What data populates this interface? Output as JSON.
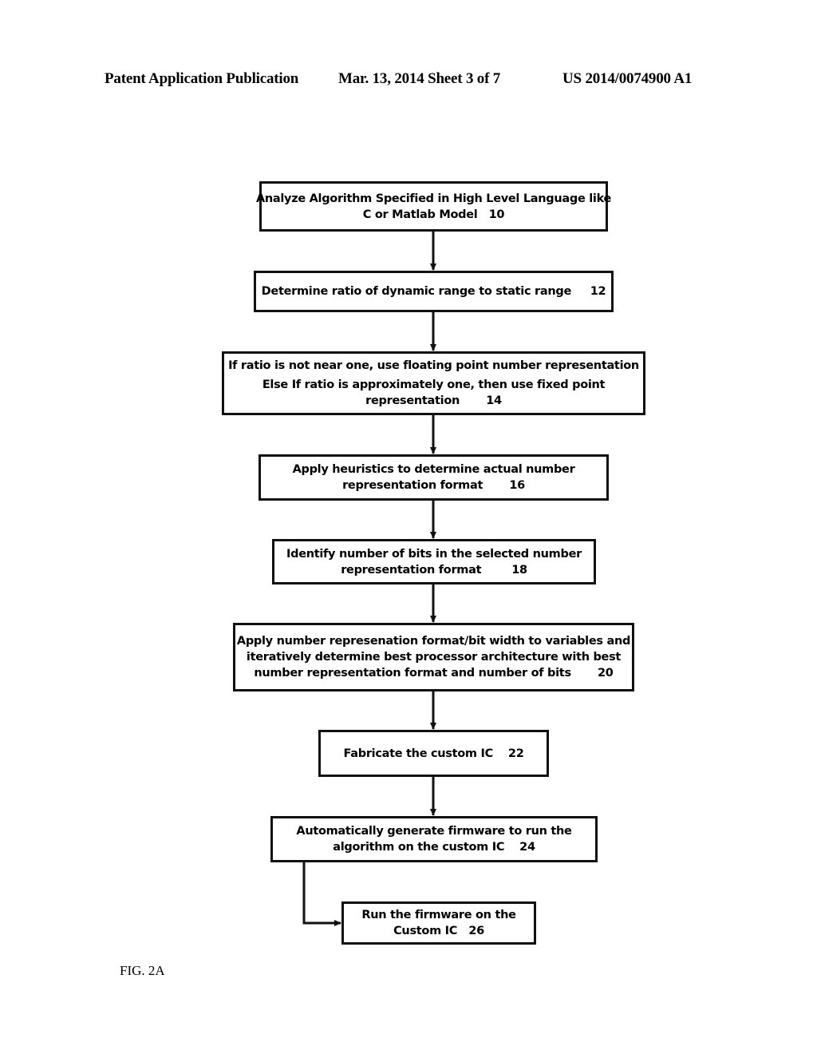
{
  "header": {
    "left": "Patent Application Publication",
    "middle": "Mar. 13, 2014  Sheet 3 of 7",
    "right": "US 2014/0074900 A1"
  },
  "flowchart": {
    "steps": [
      {
        "id": "10",
        "lines": [
          "Analyze Algorithm Specified in High Level Language like",
          "C or Matlab Model   10"
        ]
      },
      {
        "id": "12",
        "lines": [
          "Determine ratio of dynamic range to static range     12"
        ]
      },
      {
        "id": "14",
        "lines": [
          "If ratio is not near one, use floating point number representation",
          "Else If ratio is approximately one, then use fixed point",
          "representation       14"
        ]
      },
      {
        "id": "16",
        "lines": [
          "Apply heuristics to determine actual number",
          "representation format       16"
        ]
      },
      {
        "id": "18",
        "lines": [
          "Identify number of bits in the selected number",
          "representation format        18"
        ]
      },
      {
        "id": "20",
        "lines": [
          "Apply number represenation format/bit width to variables and",
          "iteratively determine best processor architecture with best",
          "number representation format and number of bits       20"
        ]
      },
      {
        "id": "22",
        "lines": [
          "Fabricate the custom IC    22"
        ]
      },
      {
        "id": "24",
        "lines": [
          "Automatically generate firmware to run the",
          "algorithm on the custom IC    24"
        ]
      },
      {
        "id": "26",
        "lines": [
          "Run the firmware on the",
          "Custom IC   26"
        ]
      }
    ]
  },
  "figure_label": "FIG. 2A"
}
